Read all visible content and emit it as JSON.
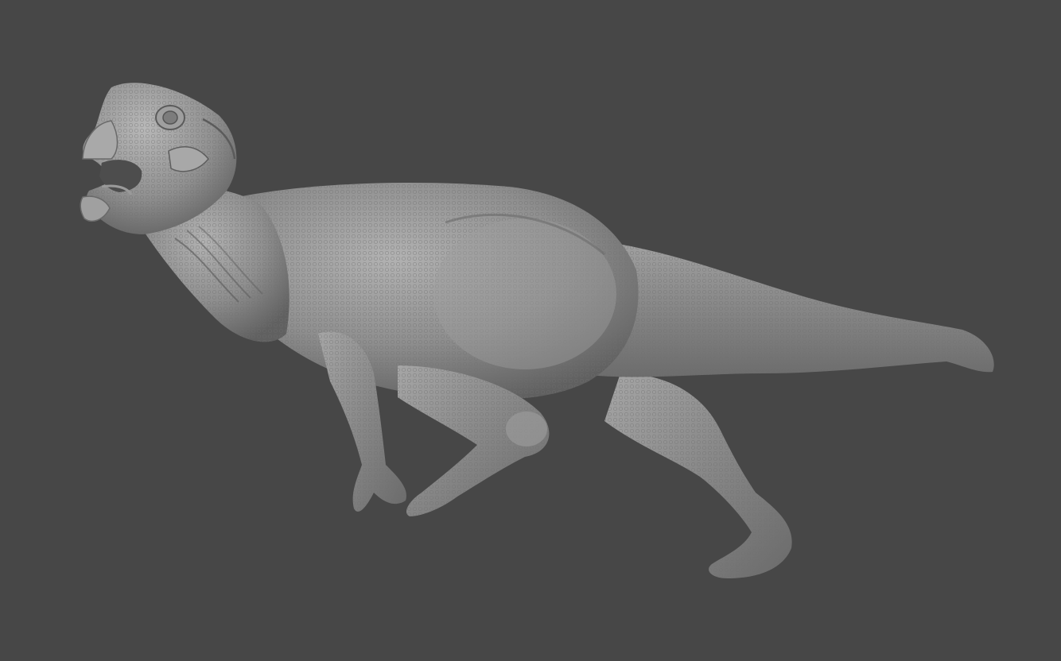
{
  "viewport": {
    "background_color": "#474747",
    "subject": "sculpted-dinosaur-model",
    "model_color": "#8e8e8e",
    "model_highlight_color": "#b4b4b4",
    "model_shadow_color": "#5e5e5e"
  }
}
